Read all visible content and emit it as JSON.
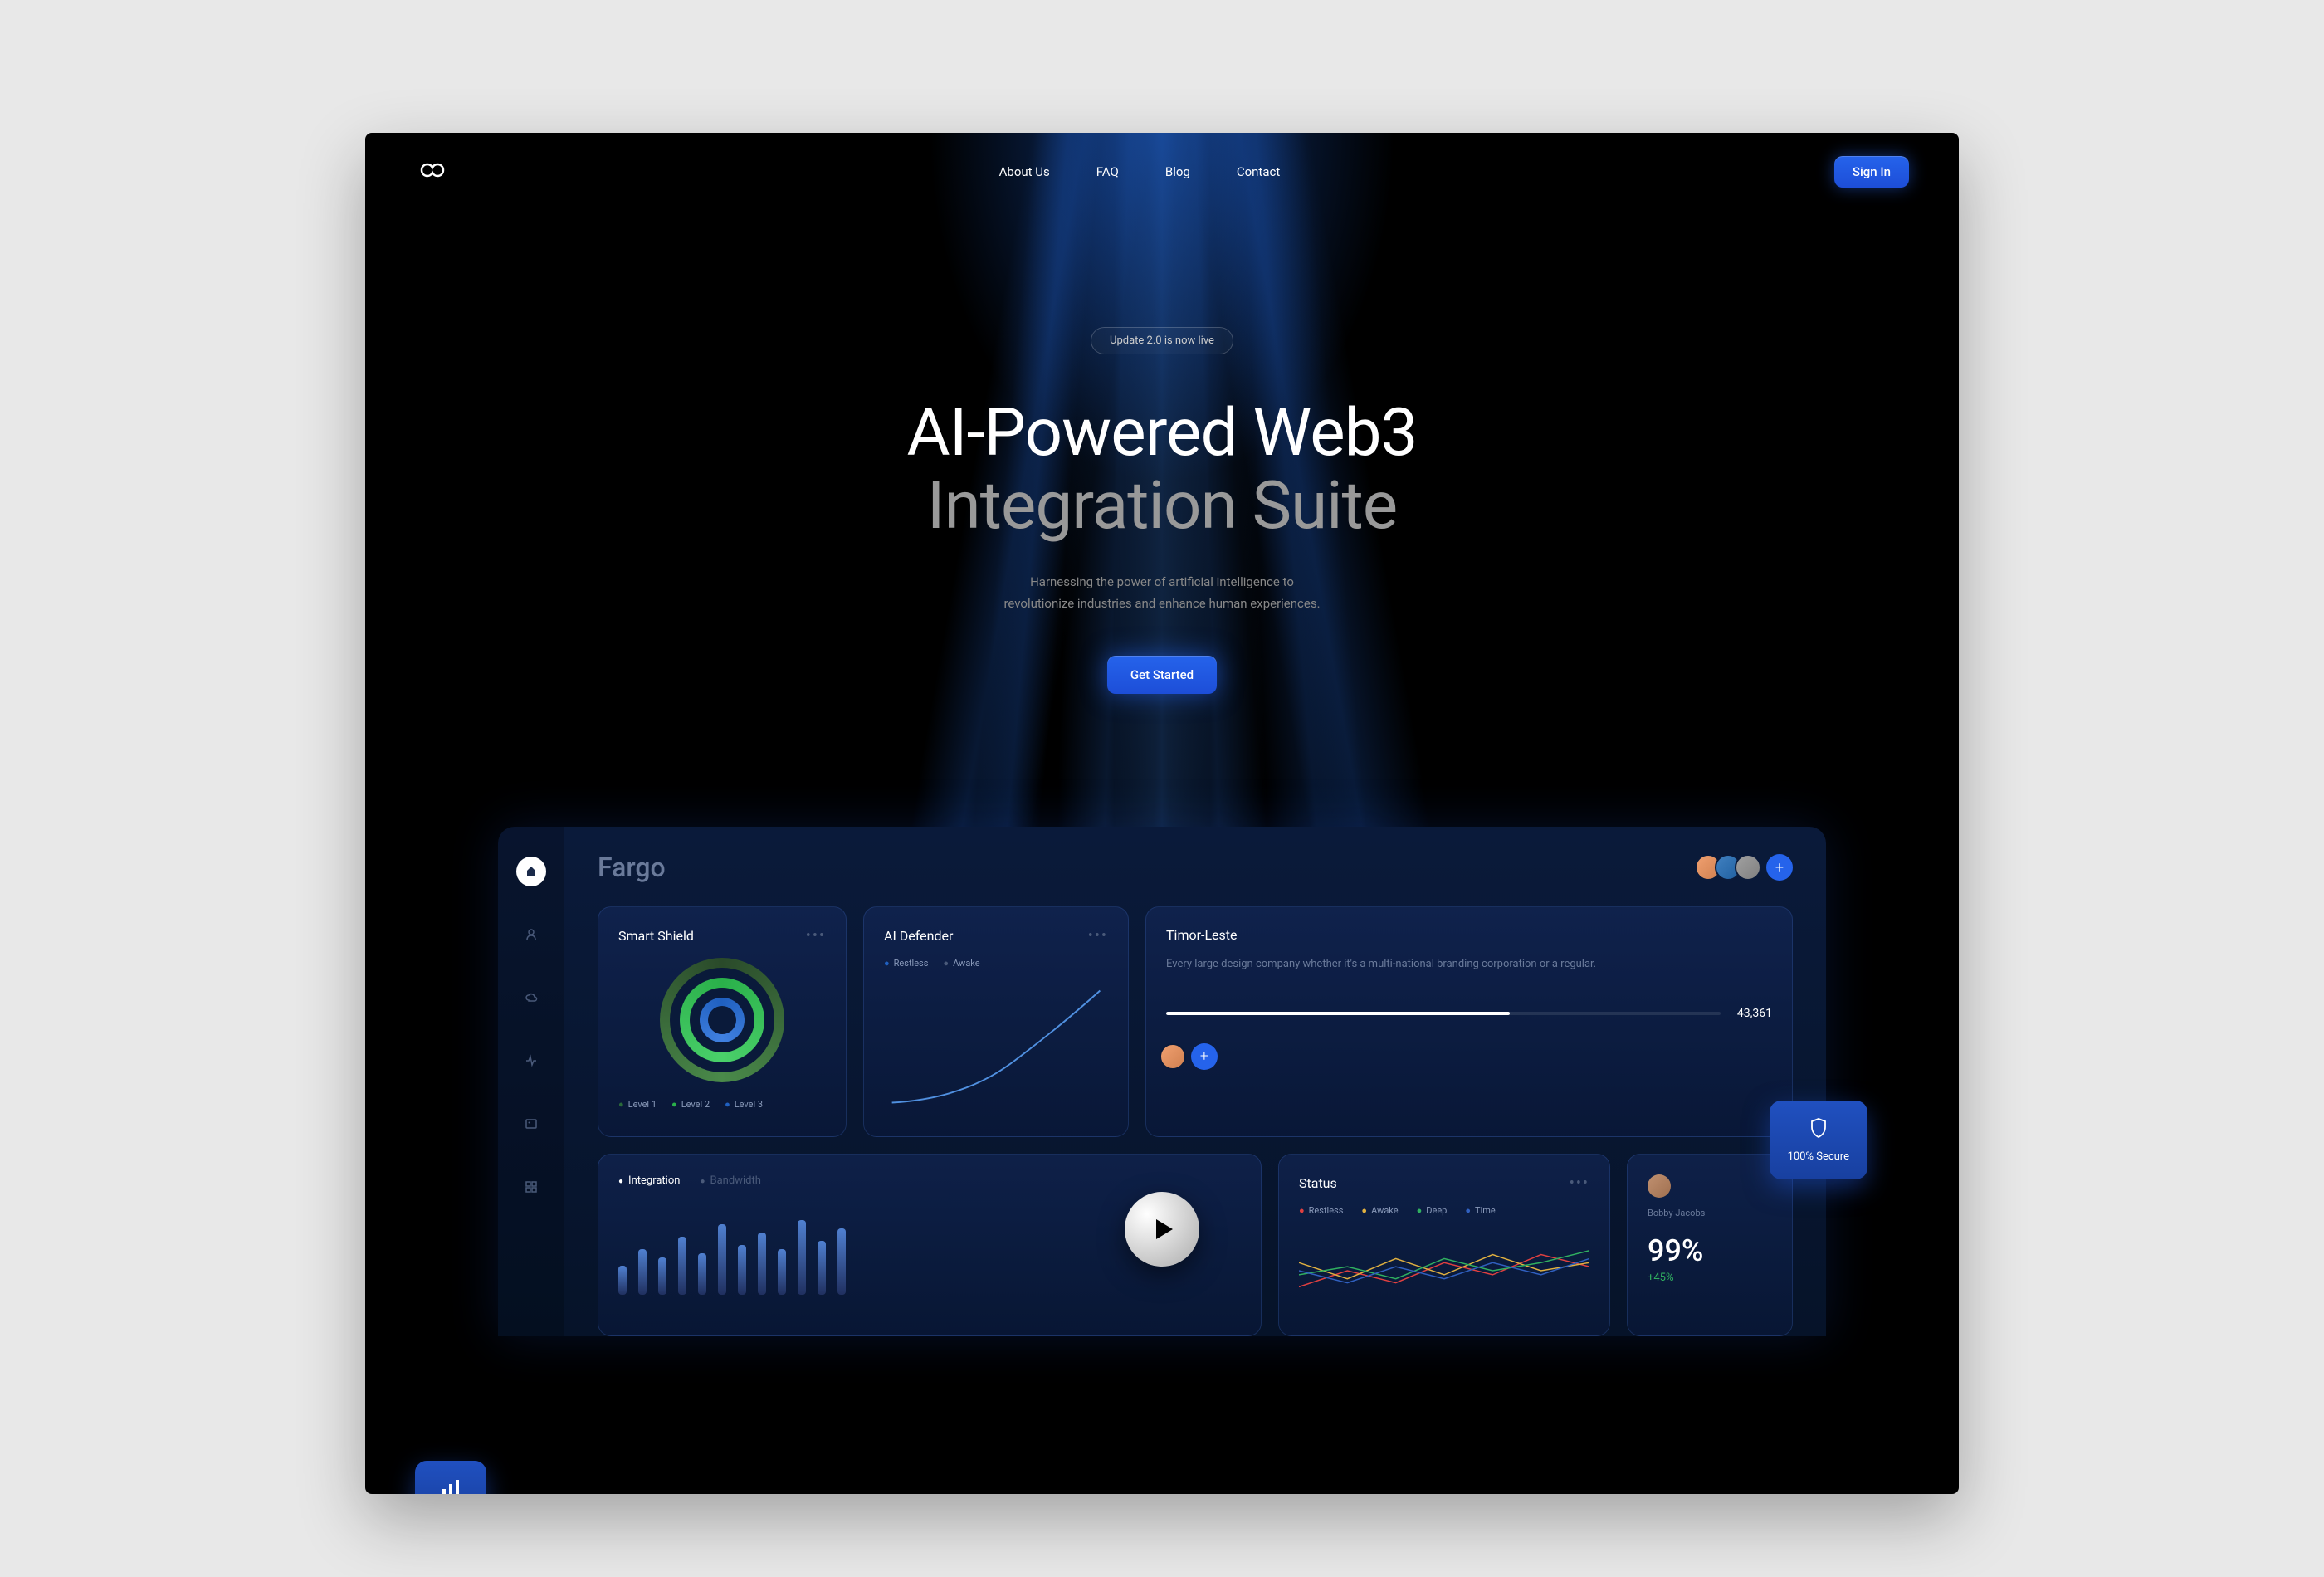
{
  "nav": {
    "about": "About Us",
    "faq": "FAQ",
    "blog": "Blog",
    "contact": "Contact",
    "signin": "Sign In"
  },
  "hero": {
    "badge": "Update 2.0 is now live",
    "title_line1": "AI-Powered Web3",
    "title_line2": "Integration Suite",
    "subtitle_line1": "Harnessing the power of artificial intelligence to",
    "subtitle_line2": "revolutionize industries and enhance human experiences.",
    "cta": "Get Started"
  },
  "dashboard": {
    "title": "Fargo",
    "shield": {
      "title": "Smart Shield",
      "level1": "Level 1",
      "level2": "Level 2",
      "level3": "Level 3"
    },
    "defender": {
      "title": "AI Defender",
      "restless": "Restless",
      "awake": "Awake"
    },
    "timor": {
      "title": "Timor-Leste",
      "desc": "Every large design company whether it's a multi-national branding corporation or a regular.",
      "value": "43,361"
    },
    "integration": {
      "tab1": "Integration",
      "tab2": "Bandwidth"
    },
    "status": {
      "title": "Status",
      "restless": "Restless",
      "awake": "Awake",
      "deep": "Deep",
      "time": "Time"
    },
    "profile": {
      "name": "Bobby Jacobs",
      "percent": "99%",
      "change": "+45%"
    },
    "secure_badge": "100% Secure"
  },
  "chart_data": [
    {
      "type": "bar",
      "title": "Integration",
      "values": [
        35,
        55,
        45,
        70,
        50,
        85,
        60,
        75,
        55,
        90,
        65,
        80
      ],
      "ylim": [
        0,
        100
      ]
    },
    {
      "type": "line",
      "title": "AI Defender",
      "series": [
        {
          "name": "Restless",
          "values": [
            5,
            8,
            14,
            25,
            42,
            68,
            100
          ]
        }
      ],
      "ylim": [
        0,
        100
      ]
    },
    {
      "type": "line",
      "title": "Status",
      "series": [
        {
          "name": "Restless",
          "values": [
            30,
            50,
            35,
            60,
            45,
            70,
            55
          ]
        },
        {
          "name": "Awake",
          "values": [
            60,
            40,
            65,
            45,
            70,
            50,
            60
          ]
        },
        {
          "name": "Deep",
          "values": [
            45,
            55,
            40,
            65,
            50,
            60,
            75
          ]
        },
        {
          "name": "Time",
          "values": [
            50,
            35,
            55,
            40,
            60,
            45,
            65
          ]
        }
      ],
      "ylim": [
        0,
        100
      ]
    }
  ]
}
